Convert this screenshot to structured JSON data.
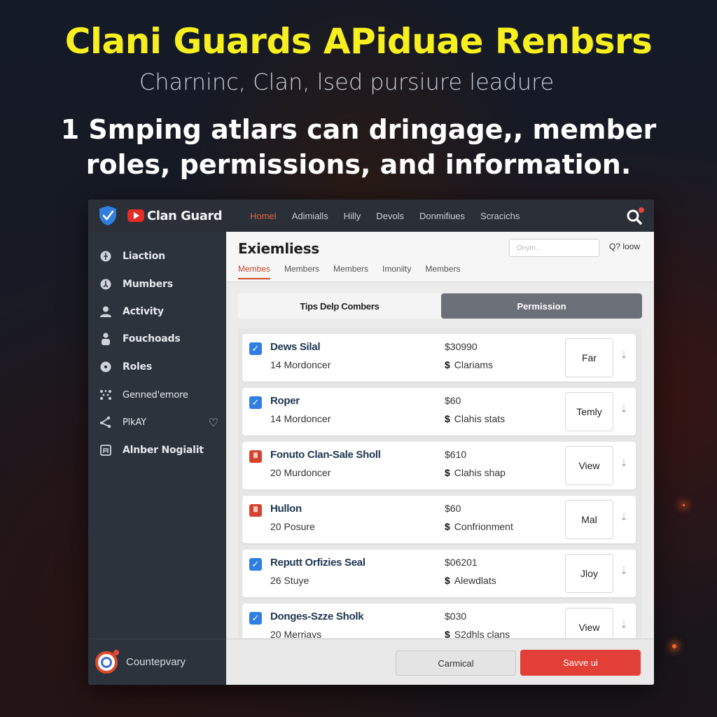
{
  "hero": {
    "title": "Clani Guards APiduae Renbsrs",
    "subtitle": "Charninc, Clan, lsed pursiure leadure",
    "description_line1": "1 Smping atlars can dringage,, member",
    "description_line2": "roles, permissions, and information."
  },
  "app": {
    "brand": "Clan Guard",
    "nav": [
      "Homel",
      "Adimialls",
      "Hilly",
      "Devols",
      "Donmifiues",
      "Scracichs"
    ],
    "nav_active_index": 0,
    "colors": {
      "accent": "#e2663a",
      "primary_blue": "#2f7ee0",
      "danger": "#e23f36",
      "title_yellow": "#f7ef1e"
    }
  },
  "sidebar": {
    "items": [
      {
        "label": "Liaction",
        "icon": "compass-icon"
      },
      {
        "label": "Mumbers",
        "icon": "clock-icon"
      },
      {
        "label": "Activity",
        "icon": "user-icon"
      },
      {
        "label": "Fouchoads",
        "icon": "person-icon"
      },
      {
        "label": "Roles",
        "icon": "disc-icon"
      },
      {
        "label": "Genned'emore",
        "icon": "dots-grid-icon"
      },
      {
        "label": "PlkAY",
        "icon": "share-icon",
        "trailing_icon": "heart-icon"
      },
      {
        "label": "Alnber Nogialit",
        "icon": "frame-icon"
      }
    ],
    "footer_name": "Countepvary"
  },
  "main": {
    "title": "Exiemliess",
    "search_placeholder": "Onym...",
    "search_extra": "Q? loow",
    "tabs": [
      "Membes",
      "Members",
      "Members",
      "Imonilty",
      "Members"
    ],
    "active_tab_index": 0,
    "segments": [
      "Tips Delp Combers",
      "Permission"
    ],
    "active_segment_index": 1,
    "rows": [
      {
        "checkbox": "checked",
        "name": "Dews Silal",
        "sub": "14 Mordoncer",
        "amount": "$30990",
        "note": "Clariams",
        "action": "Far"
      },
      {
        "checkbox": "checked",
        "name": "Roper",
        "sub": "14 Mordoncer",
        "amount": "$60",
        "note": "Clahis stats",
        "action": "Temly"
      },
      {
        "checkbox": "flag",
        "name": "Fonuto Clan-Sale Sholl",
        "sub": "20 Murdoncer",
        "amount": "$610",
        "note": "Clahis shap",
        "action": "View"
      },
      {
        "checkbox": "flag",
        "name": "Hullon",
        "sub": "20 Posure",
        "amount": "$60",
        "note": "Confrionment",
        "action": "Mal"
      },
      {
        "checkbox": "checked",
        "name": "Reputt Orfizies Seal",
        "sub": "26 Stuye",
        "amount": "$06201",
        "note": "Alewdlats",
        "action": "Jloy"
      },
      {
        "checkbox": "checked",
        "name": "Donges-Szze Sholk",
        "sub": "20 Merriays",
        "amount": "$030",
        "note": "S2dhls clans",
        "action": "View"
      }
    ],
    "dollar_sign": "$",
    "checkmark": "✓",
    "flag_glyph": "Ⅲ",
    "drag_glyph": "⇣",
    "cancel_label": "Carmical",
    "save_label": "Savve ui"
  }
}
